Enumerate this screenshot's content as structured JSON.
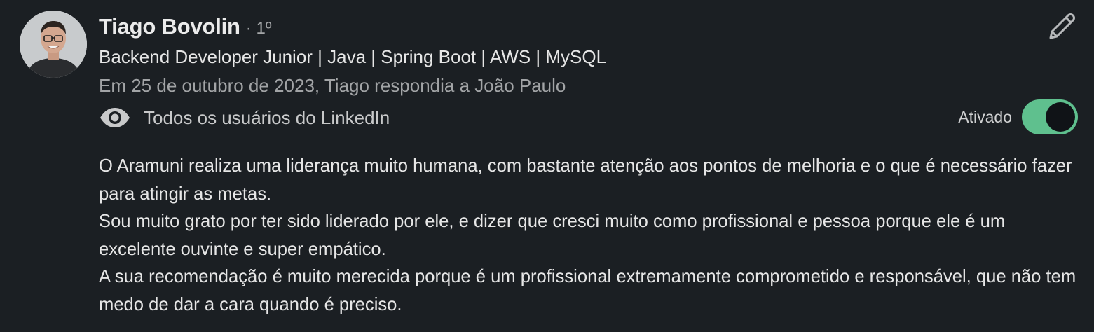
{
  "recommendation": {
    "author": {
      "name": "Tiago Bovolin",
      "degree": "· 1º",
      "headline": "Backend Developer Junior | Java | Spring Boot | AWS | MySQL"
    },
    "context": "Em 25 de outubro de 2023, Tiago respondia a João Paulo",
    "visibility": {
      "icon": "eye-icon",
      "label": "Todos os usuários do LinkedIn"
    },
    "toggle": {
      "label": "Ativado",
      "on": true,
      "color": "#5fc08e"
    },
    "edit_icon": "pencil-icon",
    "paragraphs": [
      "O Aramuni realiza uma liderança muito humana, com bastante atenção aos pontos de melhoria e o que é necessário fazer para atingir as metas.",
      "Sou muito grato por ter sido liderado por ele, e dizer que cresci muito como profissional e pessoa porque ele é um excelente ouvinte e super empático.",
      "A sua recomendação é muito merecida porque é um profissional extremamente comprometido e responsável, que não tem medo de dar a cara quando é preciso."
    ]
  }
}
